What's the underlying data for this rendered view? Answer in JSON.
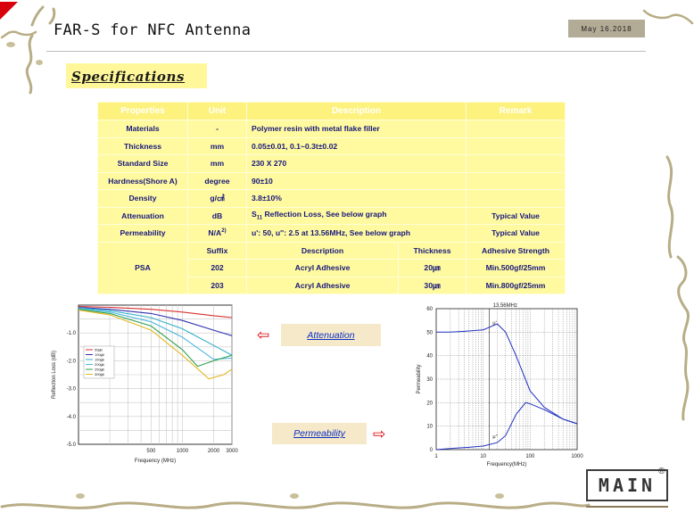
{
  "header": {
    "title": "FAR-S for NFC Antenna",
    "date": "May 16.2018"
  },
  "section": {
    "title": "Specifications"
  },
  "table": {
    "headers": [
      "Properties",
      "Unit",
      "Description",
      "Remark"
    ],
    "rows": [
      {
        "property": "Materials",
        "unit": "-",
        "description": "Polymer resin with metal flake filler",
        "remark": ""
      },
      {
        "property": "Thickness",
        "unit": "mm",
        "description": "0.05±0.01, 0.1~0.3t±0.02",
        "remark": ""
      },
      {
        "property": "Standard Size",
        "unit": "mm",
        "description": "230 X 270",
        "remark": ""
      },
      {
        "property": "Hardness(Shore A)",
        "unit": "degree",
        "description": "90±10",
        "remark": ""
      },
      {
        "property": "Density",
        "unit": "g/㎤",
        "description": "3.8±10%",
        "remark": ""
      },
      {
        "property": "Attenuation",
        "unit": "dB",
        "description_prefix": "S",
        "description_sub": "11",
        "description_suffix": " Reflection Loss, See  below  graph",
        "remark": "Typical Value"
      },
      {
        "property": "Permeability",
        "unit": "N/A",
        "unit_sup": "2)",
        "description": "u': 50, u'': 2.5 at 13.56MHz,  See below graph",
        "remark": "Typical Value"
      }
    ],
    "psa": {
      "label": "PSA",
      "headers": [
        "Suffix",
        "Description",
        "Thickness",
        "Adhesive Strength"
      ],
      "rows": [
        {
          "suffix": "202",
          "description": "Acryl Adhesive",
          "thickness": "20㎛",
          "strength": "Min.500gf/25mm"
        },
        {
          "suffix": "203",
          "description": "Acryl Adhesive",
          "thickness": "30㎛",
          "strength": "Min.800gf/25mm"
        }
      ]
    }
  },
  "labels": {
    "attenuation": "Attenuation",
    "permeability": "Permeability"
  },
  "icons": {
    "arrow_left": "⇦",
    "arrow_right": "⇨",
    "corner": "red-corner-triangle"
  },
  "colors": {
    "table_bg": "#fffaa0",
    "table_text": "#17177a",
    "accent_red": "#d8000a",
    "button_bg": "#f5e9c9",
    "link_blue": "#0b2ec2"
  },
  "logo": {
    "text": "MAIN",
    "reg": "®"
  },
  "chart_data": [
    {
      "type": "line",
      "xlabel": "Frequency (MHz)",
      "ylabel": "Reflection Loss (dB)",
      "xscale": "log",
      "x_ticks": [
        "500",
        "1000",
        "2000",
        "3000"
      ],
      "y_ticks": [
        "-1.0",
        "-2.0",
        "-3.0",
        "-4.0",
        "-5.0"
      ],
      "ylim": [
        -5.0,
        0
      ],
      "xlim": [
        100,
        3000
      ],
      "legend_placement": "left",
      "legend": [
        "50㎛",
        "100㎛",
        "150㎛",
        "200㎛",
        "250㎛",
        "300㎛"
      ],
      "series": [
        {
          "name": "50㎛",
          "color": "#d83030",
          "x": [
            100,
            200,
            500,
            1000,
            2000,
            3000
          ],
          "y": [
            -0.05,
            -0.08,
            -0.15,
            -0.25,
            -0.38,
            -0.45
          ]
        },
        {
          "name": "100㎛",
          "color": "#3030b0",
          "x": [
            100,
            200,
            500,
            1000,
            2000,
            3000
          ],
          "y": [
            -0.08,
            -0.15,
            -0.3,
            -0.55,
            -0.9,
            -1.1
          ]
        },
        {
          "name": "150㎛",
          "color": "#30b0c8",
          "x": [
            100,
            200,
            500,
            1000,
            2000,
            3000
          ],
          "y": [
            -0.1,
            -0.2,
            -0.45,
            -0.85,
            -1.45,
            -1.8
          ]
        },
        {
          "name": "200㎛",
          "color": "#50b8e0",
          "x": [
            100,
            200,
            500,
            1000,
            2000,
            3000
          ],
          "y": [
            -0.12,
            -0.25,
            -0.6,
            -1.15,
            -1.95,
            -1.9
          ]
        },
        {
          "name": "250㎛",
          "color": "#30a050",
          "x": [
            100,
            200,
            500,
            1000,
            1400,
            2000,
            3000
          ],
          "y": [
            -0.15,
            -0.3,
            -0.75,
            -1.6,
            -2.2,
            -2.0,
            -1.8
          ]
        },
        {
          "name": "300㎛",
          "color": "#e0b820",
          "x": [
            100,
            200,
            500,
            1000,
            1800,
            2500,
            3000
          ],
          "y": [
            -0.18,
            -0.35,
            -0.9,
            -1.8,
            -2.65,
            -2.5,
            -2.3
          ]
        }
      ]
    },
    {
      "type": "line",
      "xlabel": "Frequency(MHz)",
      "ylabel": "Permeability",
      "xscale": "log",
      "annotation": "13.56MHz",
      "x_ticks": [
        "1",
        "10",
        "100",
        "1000"
      ],
      "y_ticks": [
        "0",
        "10",
        "20",
        "30",
        "40",
        "50",
        "60"
      ],
      "xlim": [
        1,
        1000
      ],
      "ylim": [
        0,
        60
      ],
      "series": [
        {
          "name": "μ'",
          "color": "#2030c0",
          "x": [
            1,
            2,
            5,
            10,
            20,
            30,
            50,
            100,
            200,
            500,
            1000
          ],
          "y": [
            50,
            50,
            50.5,
            51,
            53.5,
            50,
            40,
            25,
            18,
            13,
            11
          ]
        },
        {
          "name": "μ''",
          "color": "#2030c0",
          "x": [
            1,
            2,
            5,
            10,
            20,
            30,
            50,
            80,
            100,
            200,
            500,
            1000
          ],
          "y": [
            0,
            0.5,
            1,
            1.5,
            3,
            6,
            15,
            20,
            19.5,
            17,
            13,
            11
          ]
        }
      ]
    }
  ]
}
